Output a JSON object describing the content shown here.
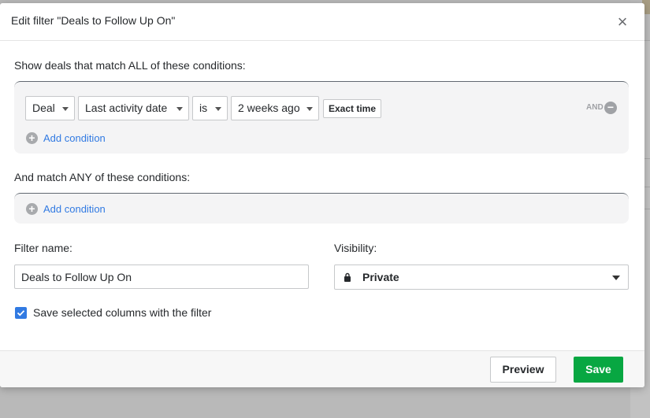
{
  "modal": {
    "title": "Edit filter \"Deals to Follow Up On\"",
    "close_symbol": "×"
  },
  "all_conditions": {
    "label": "Show deals that match ALL of these conditions:",
    "rows": [
      {
        "entity": "Deal",
        "field": "Last activity date",
        "operator": "is",
        "value": "2 weeks ago",
        "exact_time_label": "Exact time",
        "and_label": "AND",
        "remove_symbol": "−"
      }
    ],
    "add_label": "Add condition"
  },
  "any_conditions": {
    "label": "And match ANY of these conditions:",
    "add_label": "Add condition"
  },
  "filter_name": {
    "label": "Filter name:",
    "value": "Deals to Follow Up On"
  },
  "visibility": {
    "label": "Visibility:",
    "value": "Private",
    "icon": "lock-icon"
  },
  "save_columns": {
    "label": "Save selected columns with the filter",
    "checked": true
  },
  "footer": {
    "preview_label": "Preview",
    "save_label": "Save"
  },
  "colors": {
    "accent": "#317ae2",
    "save_green": "#08a742"
  }
}
